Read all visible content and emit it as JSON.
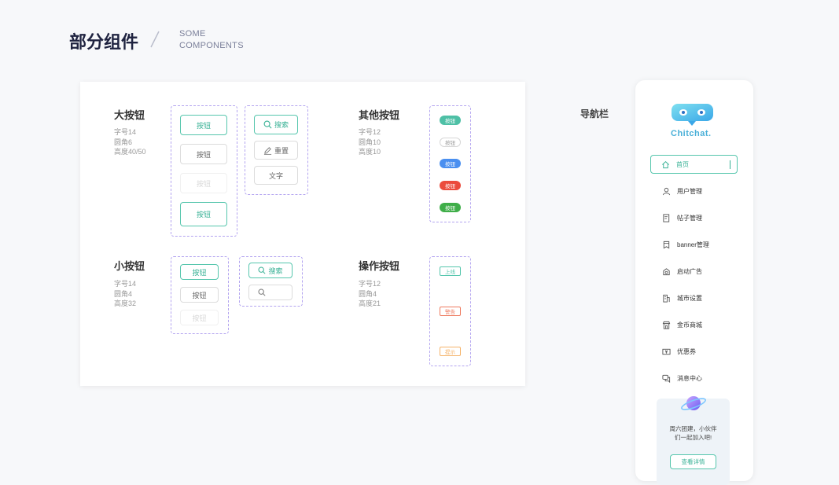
{
  "header": {
    "title": "部分组件",
    "subtitle_line1": "SOME",
    "subtitle_line2": "COMPONENTS"
  },
  "large_buttons": {
    "heading": "大按钮",
    "spec": [
      "字号14",
      "圆角6",
      "高度40/50"
    ],
    "buttons": [
      "按钮",
      "按钮",
      "按钮",
      "按钮"
    ],
    "search_label": "搜索",
    "reset_label": "重置",
    "text_label": "文字"
  },
  "other_buttons": {
    "heading": "其他按钮",
    "spec": [
      "字号12",
      "圆角10",
      "高度10"
    ],
    "pills": [
      {
        "label": "按钮",
        "color": "#4ec0a6"
      },
      {
        "label": "按钮",
        "color": "#ffffff"
      },
      {
        "label": "按钮",
        "color": "#4a8ff0"
      },
      {
        "label": "按钮",
        "color": "#eb4b3c"
      },
      {
        "label": "按钮",
        "color": "#3fae49"
      }
    ]
  },
  "small_buttons": {
    "heading": "小按钮",
    "spec": [
      "字号14",
      "圆角4",
      "高度32"
    ],
    "buttons": [
      "按钮",
      "按钮",
      "按钮"
    ],
    "search_label": "搜索"
  },
  "action_buttons": {
    "heading": "操作按钮",
    "spec": [
      "字号12",
      "圆角4",
      "高度21"
    ],
    "items": [
      {
        "label": "上线",
        "color": "#56c6ad"
      },
      {
        "label": "警告",
        "color": "#ee7a5f"
      },
      {
        "label": "提示",
        "color": "#f5b36a"
      }
    ]
  },
  "nav": {
    "section_label": "导航栏",
    "brand": "Chitchat.",
    "items": [
      {
        "label": "首页",
        "icon": "home-icon",
        "active": true
      },
      {
        "label": "用户管理",
        "icon": "user-icon"
      },
      {
        "label": "帖子管理",
        "icon": "post-icon"
      },
      {
        "label": "banner管理",
        "icon": "banner-icon"
      },
      {
        "label": "启动广告",
        "icon": "ad-icon"
      },
      {
        "label": "城市设置",
        "icon": "city-icon"
      },
      {
        "label": "金币商城",
        "icon": "shop-icon"
      },
      {
        "label": "优惠券",
        "icon": "coupon-icon"
      },
      {
        "label": "消息中心",
        "icon": "message-icon"
      }
    ],
    "promo": {
      "line1": "周六团建，小伙伴",
      "line2": "们一起加入吧!",
      "button": "查看详情"
    }
  },
  "colors": {
    "primary": "#56c6ad",
    "primary_text": "#36b094",
    "dash_border": "#b3a4f0",
    "title": "#1f2340"
  }
}
